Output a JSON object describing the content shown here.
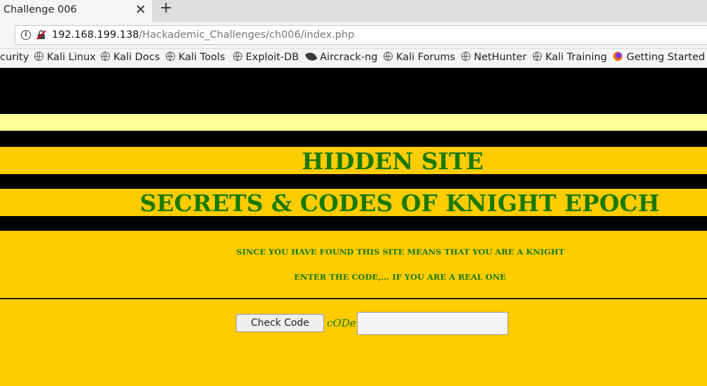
{
  "browser": {
    "tab_title": "Challenge 006",
    "tab_close": "✕",
    "new_tab": "+",
    "url_host": "192.168.199.138",
    "url_path": "/Hackademic_Challenges/ch006/index.php",
    "bookmarks": [
      {
        "label": "curity",
        "icon": "none"
      },
      {
        "label": "Kali Linux",
        "icon": "globe-icon"
      },
      {
        "label": "Kali Docs",
        "icon": "globe-icon"
      },
      {
        "label": "Kali Tools",
        "icon": "globe-icon"
      },
      {
        "label": "Exploit-DB",
        "icon": "globe-icon"
      },
      {
        "label": "Aircrack-ng",
        "icon": "aircrack-icon"
      },
      {
        "label": "Kali Forums",
        "icon": "globe-icon"
      },
      {
        "label": "NetHunter",
        "icon": "globe-icon"
      },
      {
        "label": "Kali Training",
        "icon": "globe-icon"
      },
      {
        "label": "Getting Started",
        "icon": "firefox-icon"
      }
    ]
  },
  "page": {
    "heading1": "HIDDEN SITE",
    "heading2": "SECRETS & CODES OF KNIGHT EPOCH",
    "message1": "SINCE YOU HAVE FOUND THIS SITE MEANS THAT YOU ARE A KNIGHT",
    "message2": "ENTER THE CODE,... IF YOU ARE A REAL ONE",
    "check_button": "Check Code",
    "code_label": "cODe",
    "code_value": ""
  },
  "colors": {
    "background": "#ffcc00",
    "band_black": "#000000",
    "band_light": "#ffff99",
    "text_green": "#1a7a00"
  }
}
